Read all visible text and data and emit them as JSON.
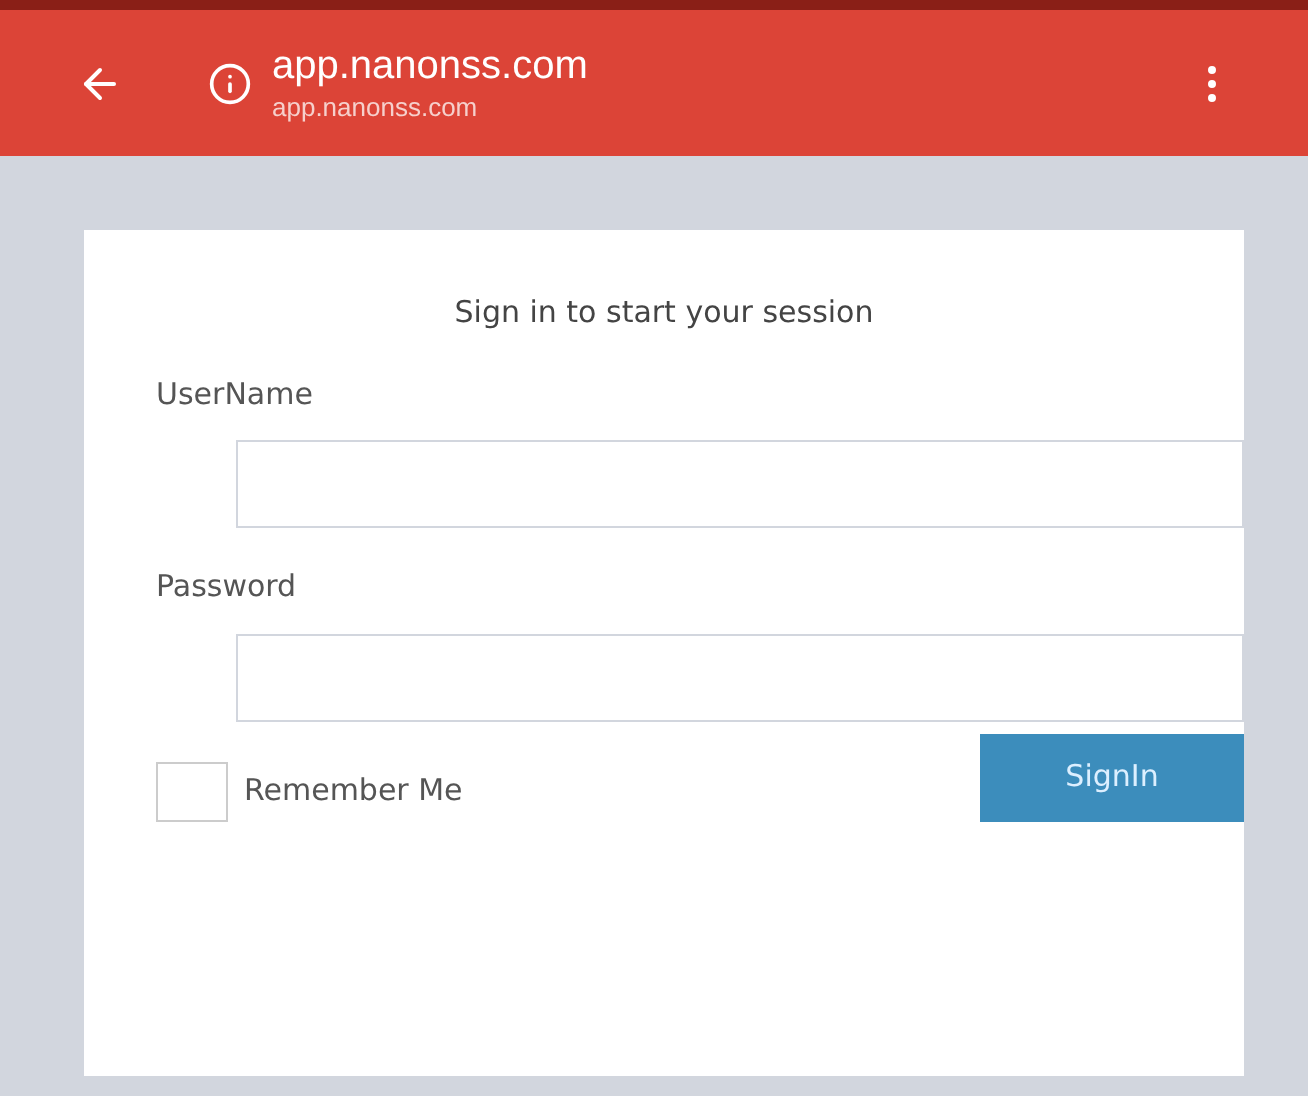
{
  "browser_bar": {
    "title": "app.nanonss.com",
    "url": "app.nanonss.com"
  },
  "login": {
    "heading": "Sign in to start your session",
    "fields": [
      {
        "label": "UserName"
      },
      {
        "label": "Password"
      }
    ],
    "remember": {
      "label": "Remember Me",
      "checked": false
    },
    "submit": "SignIn"
  }
}
